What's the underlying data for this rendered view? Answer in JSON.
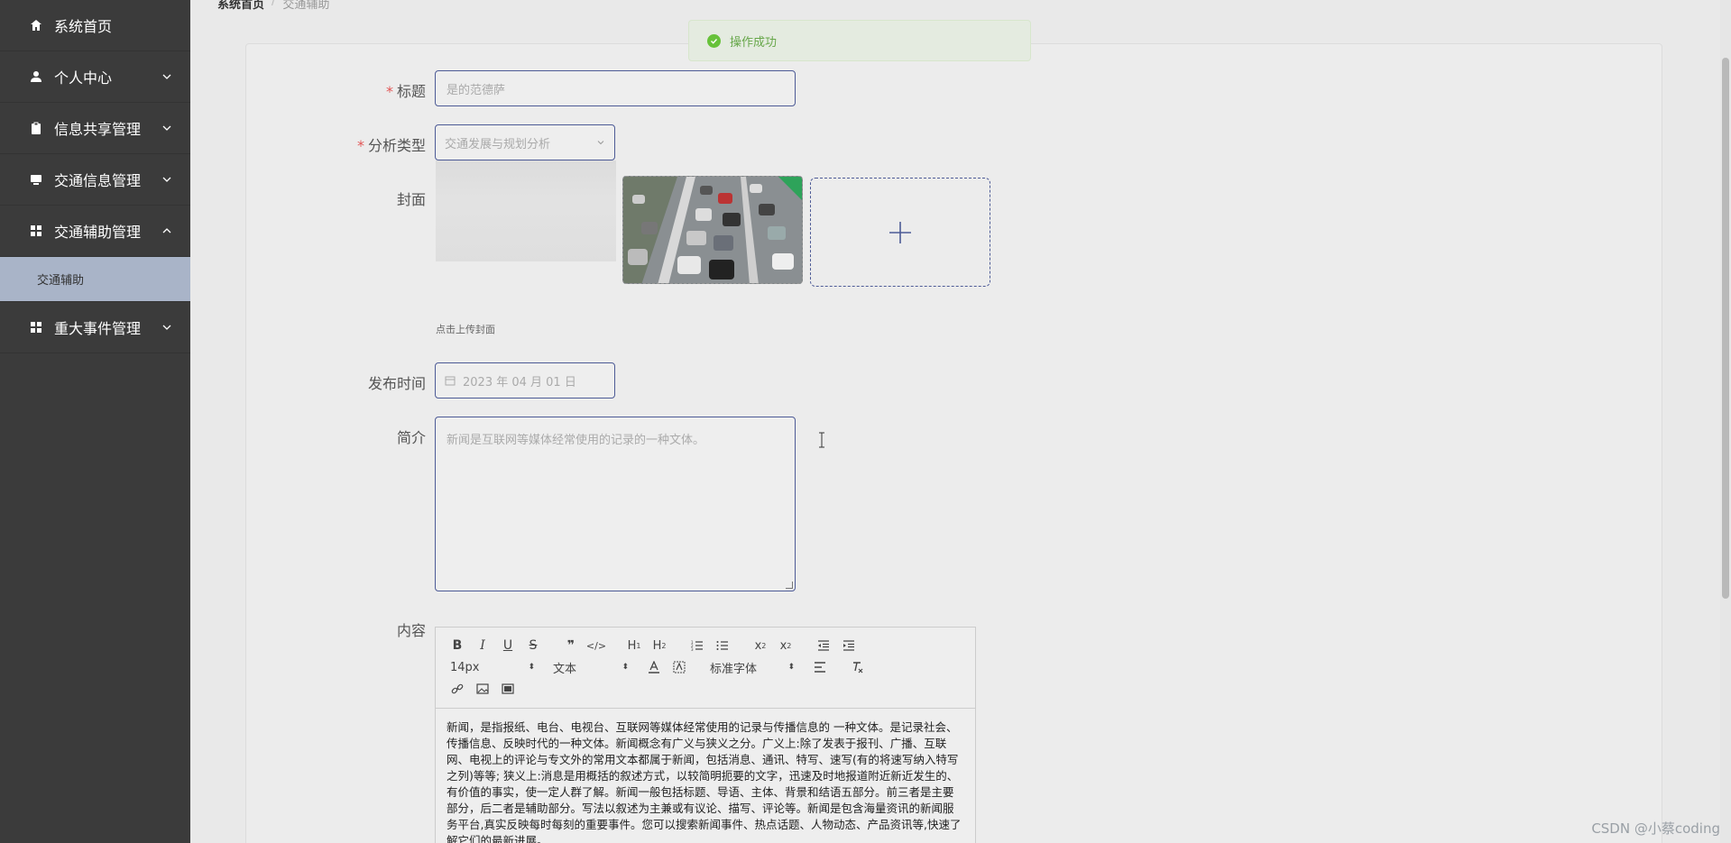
{
  "sidebar": {
    "items": [
      {
        "label": "系统首页",
        "icon": "home-icon"
      },
      {
        "label": "个人中心",
        "icon": "user-icon"
      },
      {
        "label": "信息共享管理",
        "icon": "clipboard-icon"
      },
      {
        "label": "交通信息管理",
        "icon": "monitor-icon"
      },
      {
        "label": "交通辅助管理",
        "icon": "grid-icon",
        "expanded": true
      },
      {
        "label": "重大事件管理",
        "icon": "grid-icon"
      }
    ],
    "sub_item": "交通辅助"
  },
  "breadcrumb": {
    "home": "系统首页",
    "separator": "/",
    "current": "交通辅助"
  },
  "toast": {
    "message": "操作成功",
    "color": "#67c23a"
  },
  "form": {
    "title_label": "标题",
    "title_value": "是的范德萨",
    "type_label": "分析类型",
    "type_value": "交通发展与规划分析",
    "cover_label": "封面",
    "cover_hint": "点击上传封面",
    "date_label": "发布时间",
    "date_value": "2023 年 04 月 01 日",
    "intro_label": "简介",
    "intro_value": "新闻是互联网等媒体经常使用的记录的一种文体。",
    "content_label": "内容"
  },
  "editor": {
    "font_size": "14px",
    "header_select": "文本",
    "font_family": "标准字体",
    "content": "新闻，是指报纸、电台、电视台、互联网等媒体经常使用的记录与传播信息的 一种文体。是记录社会、传播信息、反映时代的一种文体。新闻概念有广义与狭义之分。广义上:除了发表于报刊、广播、互联网、电视上的评论与专文外的常用文本都属于新闻，包括消息、通讯、特写、速写(有的将速写纳入特写之列)等等; 狭义上:消息是用概括的叙述方式，以较简明扼要的文字，迅速及时地报道附近新近发生的、有价值的事实，使一定人群了解。新闻一般包括标题、导语、主体、背景和结语五部分。前三者是主要部分，后二者是辅助部分。写法以叙述为主兼或有议论、描写、评论等。新闻是包含海量资讯的新闻服务平台,真实反映每时每刻的重要事件。您可以搜索新闻事件、热点话题、人物动态、产品资讯等,快速了解它们的最新进展。"
  },
  "watermark": "CSDN @小蔡coding",
  "colors": {
    "sidebar_bg": "#3b3b3b",
    "accent": "#4d5b96",
    "active_sub": "#a9b4c8"
  }
}
